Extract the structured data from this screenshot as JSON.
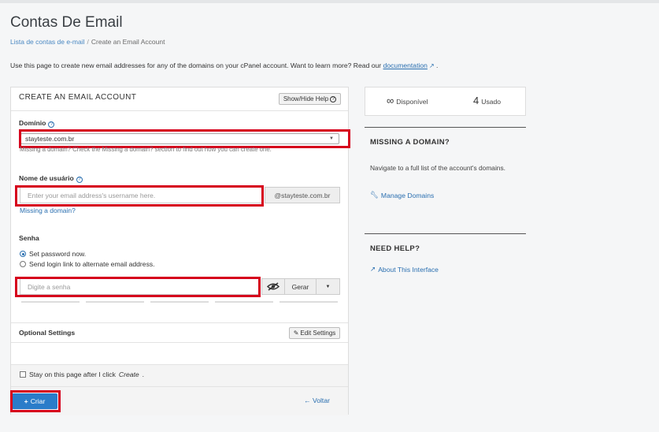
{
  "header": {
    "title": "Contas De Email",
    "breadcrumb": {
      "parent": "Lista de contas de e-mail",
      "current": "Create an Email Account"
    },
    "intro_text": "Use this page to create new email addresses for any of the domains on your cPanel account. Want to learn more? Read our",
    "intro_link": "documentation",
    "intro_end": "."
  },
  "form": {
    "panel_title": "CREATE AN EMAIL ACCOUNT",
    "help_button": "Show/Hide Help",
    "domain_label": "Domínio",
    "domain_value": "stayteste.com.br",
    "domain_hint": "Missing a domain? Check the Missing a domain? section to find out how you can create one.",
    "username_label": "Nome de usuário",
    "username_placeholder": "Enter your email address's username here.",
    "username_suffix": "@stayteste.com.br",
    "missing_domain_link": "Missing a domain?",
    "password_label": "Senha",
    "radio_set_password": "Set password now.",
    "radio_send_link": "Send login link to alternate email address.",
    "password_placeholder": "Digite a senha",
    "generate_button": "Gerar",
    "optional_label": "Optional Settings",
    "edit_settings_button": "Edit Settings",
    "stay_label": "Stay on this page after I click",
    "stay_create": "Create",
    "create_button": "Criar",
    "back_link": "Voltar"
  },
  "sidebar": {
    "available_symbol": "∞",
    "available_label": "Disponível",
    "used_count": "4",
    "used_label": "Usado",
    "missing_title": "MISSING A DOMAIN?",
    "missing_text": "Navigate to a full list of the account's domains.",
    "manage_link": "Manage Domains",
    "help_title": "NEED HELP?",
    "about_link": "About This Interface"
  },
  "colors": {
    "accent": "#2a7cc9",
    "highlight": "#d6001c",
    "link": "#2a6fb0"
  }
}
